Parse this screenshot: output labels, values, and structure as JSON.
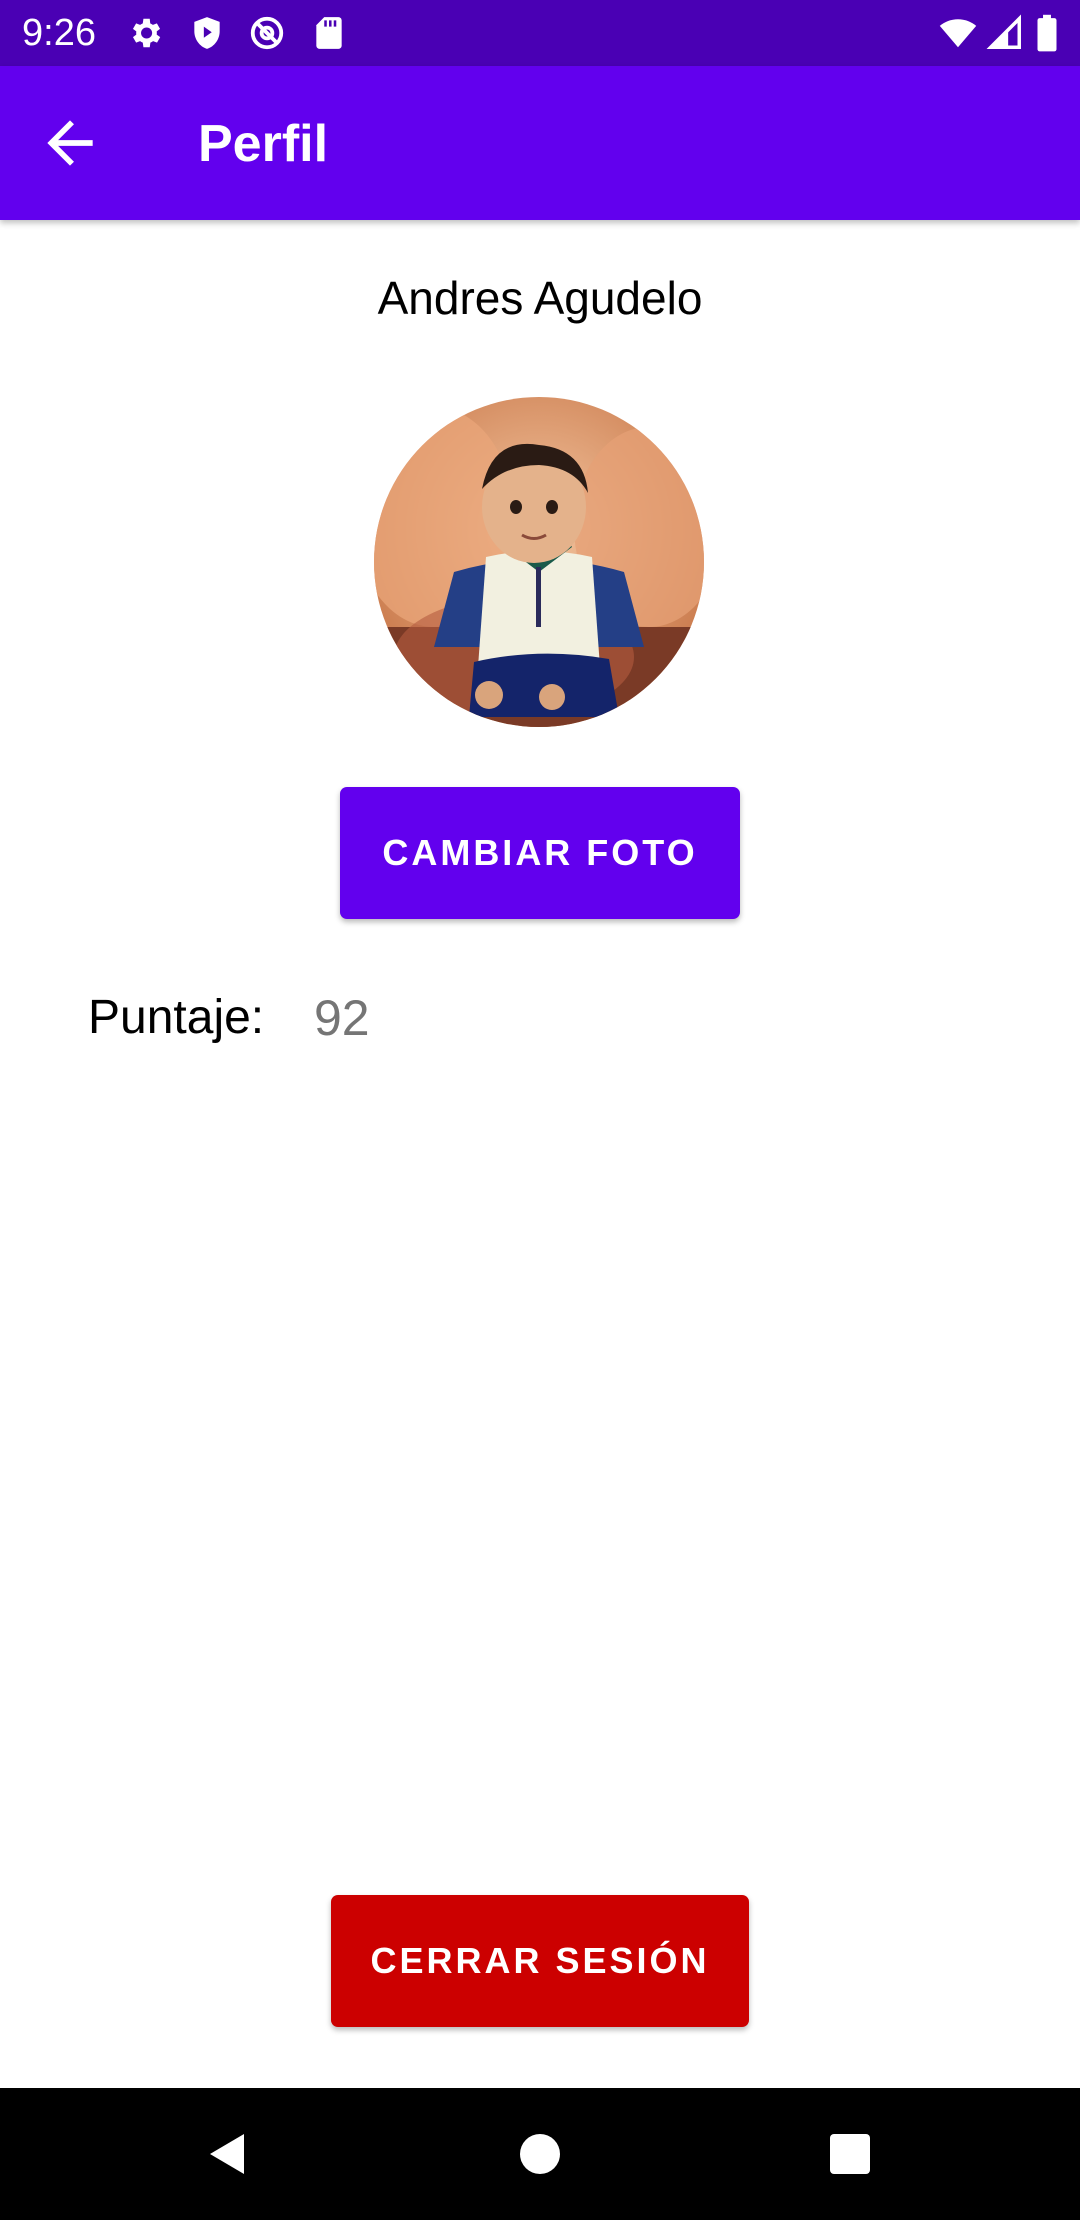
{
  "status_bar": {
    "time": "9:26",
    "icons_left": [
      "gear-icon",
      "shield-play-icon",
      "at-sign-icon",
      "sd-card-icon"
    ],
    "icons_right": [
      "wifi-icon",
      "cell-signal-icon",
      "battery-icon"
    ],
    "background": "#4a00b4"
  },
  "app_bar": {
    "title": "Perfil",
    "back_icon": "arrow-left-icon",
    "background": "#6200ee"
  },
  "profile": {
    "name": "Andres Agudelo",
    "change_photo_label": "CAMBIAR FOTO",
    "score_label": "Puntaje:",
    "score_value": "92"
  },
  "logout": {
    "label": "CERRAR SESIÓN",
    "color": "#cc0000"
  },
  "nav_bar": {
    "buttons": [
      "back-triangle-icon",
      "home-circle-icon",
      "recents-square-icon"
    ]
  },
  "colors": {
    "primary": "#6200ee",
    "danger": "#cc0000",
    "score_text": "#757575"
  }
}
